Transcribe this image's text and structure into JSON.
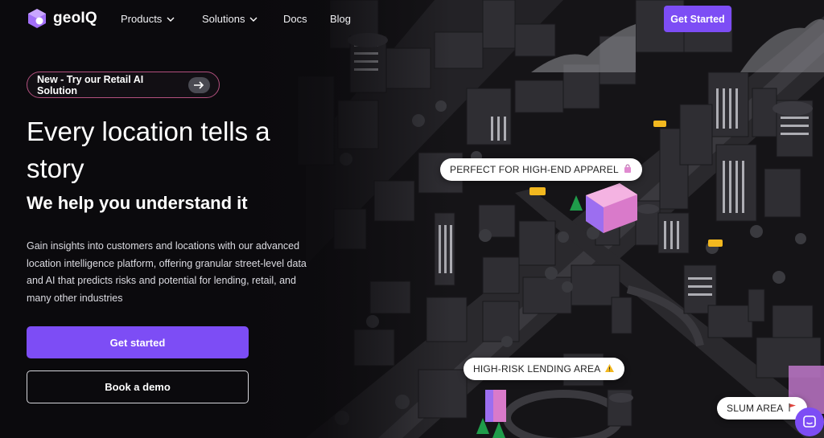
{
  "brand": {
    "name": "geoIQ",
    "accent": "#7d4df5"
  },
  "nav": {
    "items": [
      {
        "label": "Products",
        "has_dropdown": true
      },
      {
        "label": "Solutions",
        "has_dropdown": true
      },
      {
        "label": "Docs",
        "has_dropdown": false
      },
      {
        "label": "Blog",
        "has_dropdown": false
      }
    ],
    "cta_label": "Get Started"
  },
  "hero": {
    "announcement": "New - Try our Retail AI Solution",
    "title": "Every location tells a story",
    "subtitle": "We help you understand it",
    "description": "Gain insights into customers and locations with our advanced location intelligence platform, offering granular street-level data and AI that predicts risks and potential for lending, retail, and many other industries",
    "primary_button": "Get started",
    "secondary_button": "Book a demo"
  },
  "map_tags": [
    {
      "label": "PERFECT FOR HIGH-END APPAREL",
      "icon": "shopping-bag-icon"
    },
    {
      "label": "HIGH-RISK LENDING AREA",
      "icon": "warning-icon"
    },
    {
      "label": "SLUM AREA",
      "icon": "flag-icon"
    }
  ],
  "icons": {
    "arrow": "arrow-right-icon",
    "chat": "chat-icon",
    "chevron": "chevron-down-icon"
  }
}
